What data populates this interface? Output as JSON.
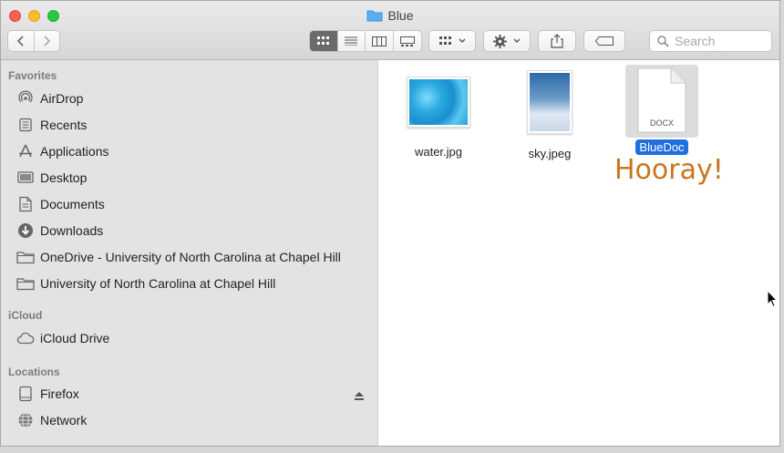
{
  "window": {
    "title": "Blue"
  },
  "toolbar": {
    "back_icon": "chevron-left-icon",
    "forward_icon": "chevron-right-icon",
    "views": [
      "icon-view-icon",
      "list-view-icon",
      "column-view-icon",
      "gallery-view-icon"
    ],
    "active_view": "icon-view-icon",
    "search_placeholder": "Search"
  },
  "sidebar": {
    "favorites_header": "Favorites",
    "favorites": [
      {
        "label": "AirDrop",
        "icon": "airdrop-icon"
      },
      {
        "label": "Recents",
        "icon": "recents-icon"
      },
      {
        "label": "Applications",
        "icon": "applications-icon"
      },
      {
        "label": "Desktop",
        "icon": "desktop-icon"
      },
      {
        "label": "Documents",
        "icon": "documents-icon"
      },
      {
        "label": "Downloads",
        "icon": "downloads-icon"
      },
      {
        "label": "OneDrive - University of North Carolina at Chapel Hill",
        "icon": "folder-icon"
      },
      {
        "label": "University of North Carolina at Chapel Hill",
        "icon": "folder-icon"
      }
    ],
    "icloud_header": "iCloud",
    "icloud": [
      {
        "label": "iCloud Drive",
        "icon": "cloud-icon"
      }
    ],
    "locations_header": "Locations",
    "locations": [
      {
        "label": "Firefox",
        "icon": "disk-icon"
      },
      {
        "label": "Network",
        "icon": "network-icon"
      }
    ]
  },
  "files": [
    {
      "name": "water.jpg",
      "kind": "image",
      "selected": false
    },
    {
      "name": "sky.jpeg",
      "kind": "image",
      "selected": false
    },
    {
      "name": "BlueDoc",
      "kind": "document",
      "badge": "DOCX",
      "selected": true
    }
  ],
  "annotation": "Hooray!",
  "colors": {
    "selection": "#1f6fe0",
    "annotation": "#c87621",
    "sidebar_bg": "#e4e3e4"
  }
}
